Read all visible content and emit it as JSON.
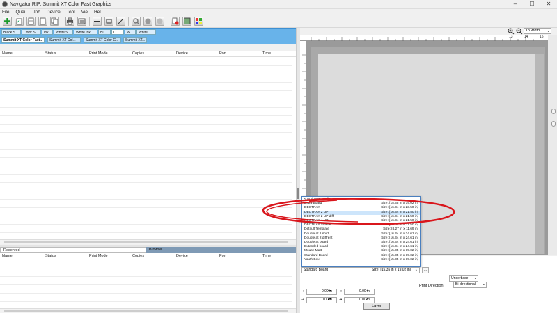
{
  "window": {
    "title": "Navigator RIP: Summit XT Color Fast Graphics",
    "controls": {
      "minimize": "–",
      "maximize": "☐",
      "close": "✕"
    }
  },
  "menu": [
    "File",
    "Queu",
    "Job",
    "Device",
    "Tool",
    "Vie",
    "Hel"
  ],
  "toolbar": {
    "buttons": [
      "add-icon",
      "open-icon",
      "import-icon",
      "page-icon",
      "copy-icon",
      "print-icon",
      "queue-icon",
      "nest-icon",
      "crop-icon",
      "split-icon",
      "zoom-icon",
      "stop-icon",
      "delete-icon",
      "device-icon",
      "color-icon",
      "grid-icon"
    ]
  },
  "profile_tabs": [
    "Black S...",
    "Color S...",
    "Ink...",
    "White S...",
    "White Ink...",
    "Bl...",
    "C...",
    "W...",
    "White..."
  ],
  "device_tabs": [
    "Summit XT Color Fast...",
    "Summit XT Col...",
    "Summit XT Color G...",
    "Summit XT..."
  ],
  "queue_columns": [
    "Name",
    "Status",
    "Print Mode",
    "Copies",
    "Device",
    "Port",
    "Time"
  ],
  "lower_tabs": {
    "reserved": "Reserved",
    "browse": "Browse"
  },
  "lower_columns": [
    "Name",
    "Status",
    "Print Mode",
    "Copies",
    "Device",
    "Port",
    "Time"
  ],
  "zoom": {
    "value": "To width"
  },
  "ruler_h": [
    "1",
    "2",
    "3",
    "4",
    "5",
    "6",
    "7",
    "8",
    "9",
    "10",
    "11",
    "12",
    "13",
    "14",
    "15"
  ],
  "ruler_v": [
    "2",
    "4",
    "6",
    "8",
    "10",
    "12",
    "14",
    "16",
    "18",
    "20",
    "22"
  ],
  "media_dropdown": {
    "add_new": "< Add New Media... >",
    "items": [
      {
        "name": "Extra Board",
        "size": "Size: [15.35 in x 19.02 in]"
      },
      {
        "name": "DECTRAY",
        "size": "Size: [16.34 in x 23.50 in]"
      },
      {
        "name": "DECTRAY 2 UP",
        "size": "Size: [16.34 in x 21.50 in]"
      },
      {
        "name": "DECTRAY 2 UP diff",
        "size": "Size: [16.34 in x 21.50 in]"
      },
      {
        "name": "DECTRAY 4 UP",
        "size": "Size: [16.34 in x 21.50 in]"
      },
      {
        "name": "DECTRAY Sleeve",
        "size": "Size: [16.34 in x 21.50 in]"
      },
      {
        "name": "Default Template",
        "size": "Size: [8.27 in x 11.69 in]"
      },
      {
        "name": "Double at 1 shirt",
        "size": "Size: [16.34 in x 24.61 in]"
      },
      {
        "name": "Double at 2 diffrent",
        "size": "Size: [16.34 in x 24.61 in]"
      },
      {
        "name": "Double at board",
        "size": "Size: [16.34 in x 24.61 in]"
      },
      {
        "name": "Extended board",
        "size": "Size: [16.34 in x 24.61 in]"
      },
      {
        "name": "Mouse Matt",
        "size": "Size: [15.35 in x 19.02 in]"
      },
      {
        "name": "Standard Board",
        "size": "Size: [15.35 in x 19.02 in]"
      },
      {
        "name": "Youth Box",
        "size": "Size: [15.35 in x 19.02 in]"
      }
    ]
  },
  "media_select": {
    "name": "Standard Board",
    "size": "Size: [15.35 in x 19.02 in]",
    "more": "..."
  },
  "underbase": "Underbase",
  "print_direction": {
    "label": "Print Direction",
    "value": "Bi-directional"
  },
  "offsets": {
    "x1": "0.00 in",
    "y1": "0.00 in",
    "x2": "0.00 in",
    "y2": "0.00 in"
  },
  "layer_button": "Layer",
  "colors": {
    "tab_blue": "#68b3ea",
    "highlight_red": "#d9161c",
    "browse_tab": "#7f9ab5"
  }
}
